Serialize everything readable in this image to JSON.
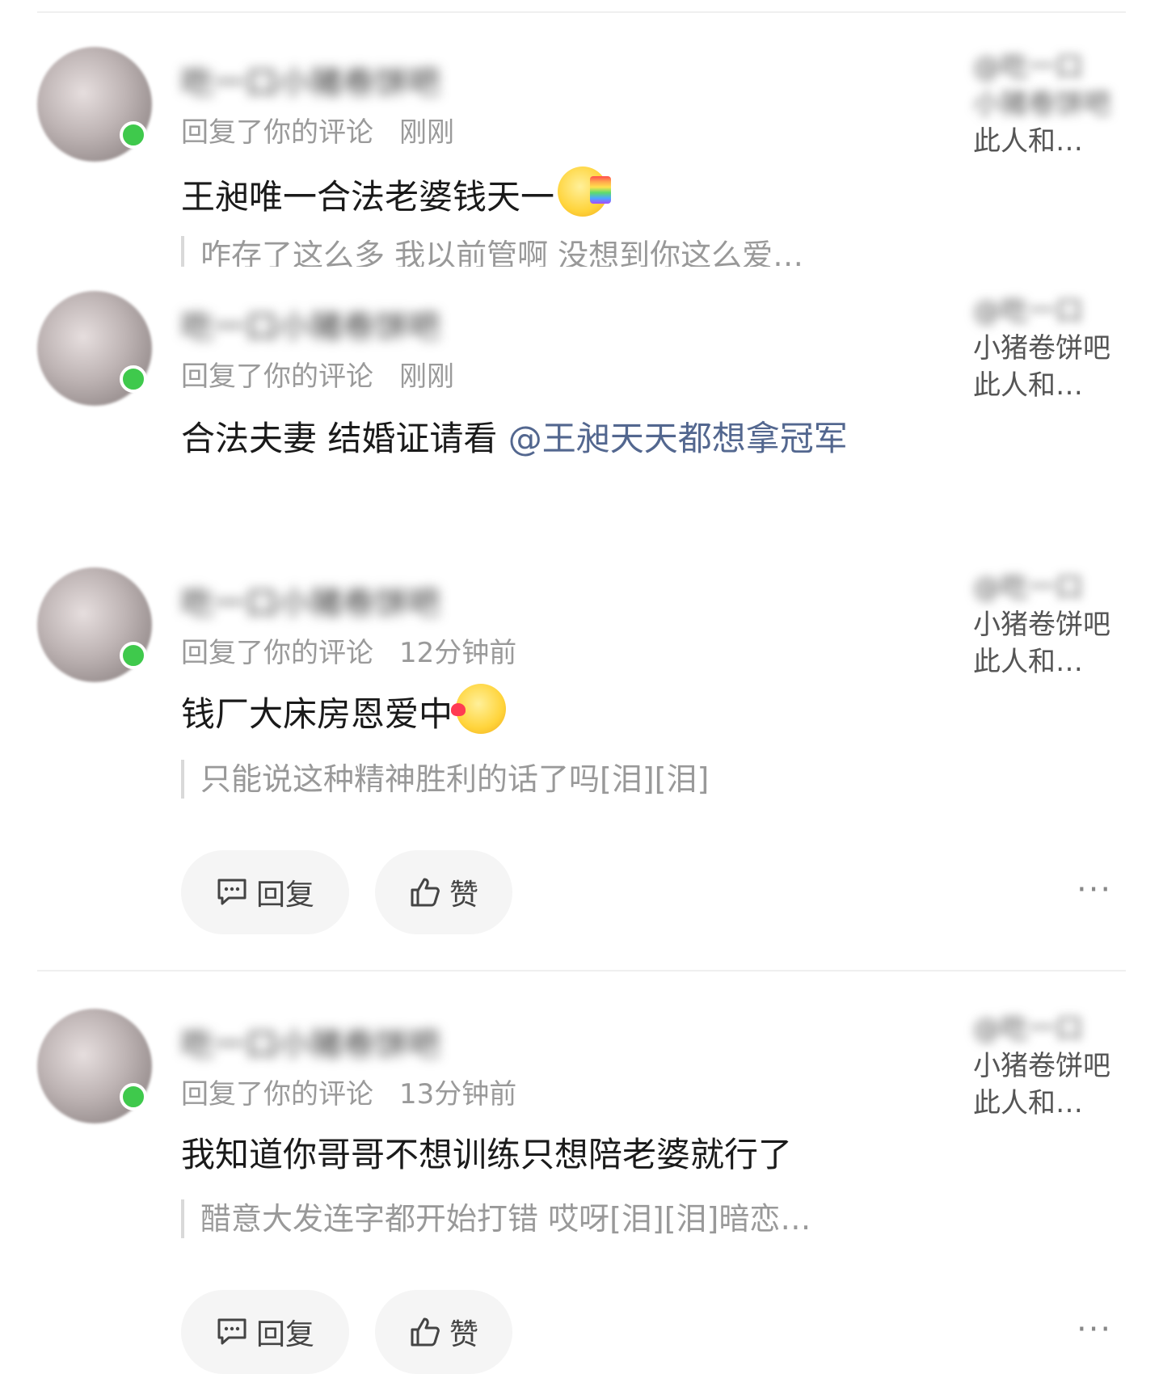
{
  "notifications": [
    {
      "username": "吃一口小猪卷饼吧",
      "action": "回复了你的评论",
      "time": "刚刚",
      "content_text": "王昶唯一合法老婆钱天一",
      "content_mention": "",
      "content_emoji": "rainbow-kiss-emoji",
      "quote": "咋存了这么多 我以前管啊 没想到你这么爱…",
      "source_line1": "@吃一口",
      "source_line2": "小猪卷饼吧",
      "source_line3": "此人和…"
    },
    {
      "username": "吃一口小猪卷饼吧",
      "action": "回复了你的评论",
      "time": "刚刚",
      "content_text": "合法夫妻 结婚证请看 ",
      "content_mention": "@王昶天天都想拿冠军",
      "content_emoji": "",
      "quote": "",
      "source_line1": "@吃一口",
      "source_line2": "小猪卷饼吧",
      "source_line3": "此人和…"
    },
    {
      "username": "吃一口小猪卷饼吧",
      "action": "回复了你的评论",
      "time": "12分钟前",
      "content_text": "钱厂大床房恩爱中",
      "content_mention": "",
      "content_emoji": "kiss-heart-emoji",
      "quote": "只能说这种精神胜利的话了吗[泪][泪]",
      "source_line1": "@吃一口",
      "source_line2": "小猪卷饼吧",
      "source_line3": "此人和…",
      "reply_label": "回复",
      "like_label": "赞",
      "more_label": "···"
    },
    {
      "username": "吃一口小猪卷饼吧",
      "action": "回复了你的评论",
      "time": "13分钟前",
      "content_text": "我知道你哥哥不想训练只想陪老婆就行了",
      "content_mention": "",
      "content_emoji": "",
      "quote": "醋意大发连字都开始打错 哎呀[泪][泪]暗恋…",
      "source_line1": "@吃一口",
      "source_line2": "小猪卷饼吧",
      "source_line3": "此人和…",
      "reply_label": "回复",
      "like_label": "赞",
      "more_label": "···"
    }
  ],
  "colors": {
    "mention": "#53678f",
    "online": "#3fc94c",
    "meta": "#9a9a9a",
    "pill_bg": "#f5f5f5"
  }
}
